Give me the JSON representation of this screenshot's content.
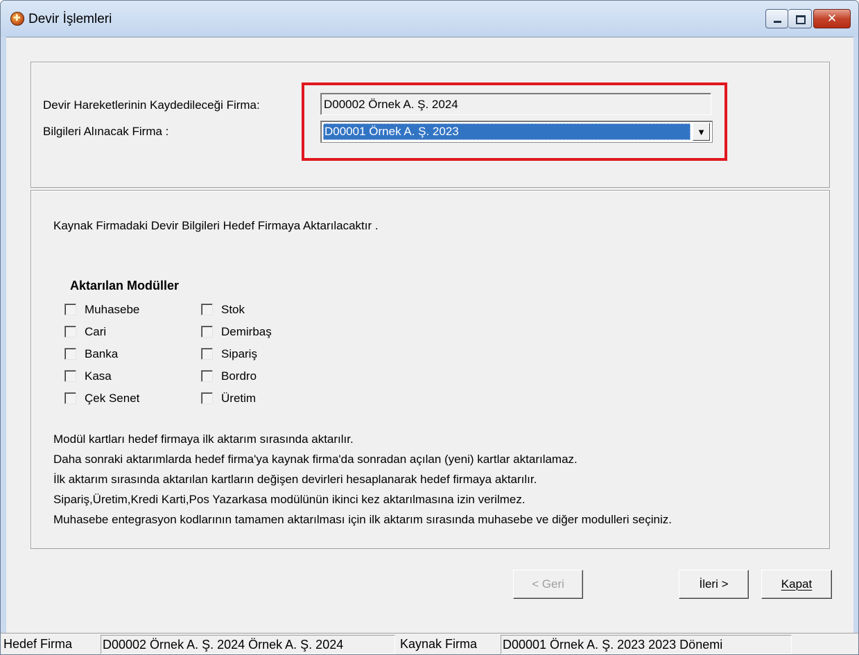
{
  "window": {
    "title": "Devir İşlemleri",
    "controls": {
      "minimize": "minimize",
      "maximize": "maximize",
      "close": "✕"
    }
  },
  "form": {
    "target_label": "Devir Hareketlerinin Kaydedileceği Firma:",
    "target_value": "D00002 Örnek A. Ş. 2024",
    "source_label": "Bilgileri Alınacak Firma :",
    "source_value": "D00001 Örnek A. Ş. 2023",
    "highlight_color": "#e0181f"
  },
  "info": {
    "intro": "Kaynak Firmadaki Devir Bilgileri Hedef Firmaya  Aktarılacaktır .",
    "modules_title": "Aktarılan Modüller",
    "modules_left": [
      {
        "label": "Muhasebe",
        "checked": false
      },
      {
        "label": "Cari",
        "checked": false
      },
      {
        "label": "Banka",
        "checked": false
      },
      {
        "label": "Kasa",
        "checked": false
      },
      {
        "label": "Çek Senet",
        "checked": false
      }
    ],
    "modules_right": [
      {
        "label": "Stok",
        "checked": false
      },
      {
        "label": "Demirbaş",
        "checked": false
      },
      {
        "label": "Sipariş",
        "checked": false
      },
      {
        "label": "Bordro",
        "checked": false
      },
      {
        "label": "Üretim",
        "checked": false
      }
    ],
    "notes": [
      "Modül kartları  hedef firmaya ilk aktarım sırasında  aktarılır.",
      "Daha sonraki aktarımlarda hedef firma'ya kaynak firma'da sonradan açılan  (yeni)  kartlar aktarılamaz.",
      "İlk aktarım sırasında aktarılan kartların değişen devirleri hesaplanarak hedef firmaya aktarılır.",
      "Sipariş,Üretim,Kredi Karti,Pos Yazarkasa  modülünün ikinci kez aktarılmasına izin verilmez.",
      "Muhasebe entegrasyon kodlarının tamamen aktarılması için ilk aktarım sırasında muhasebe ve diğer modulleri seçiniz."
    ]
  },
  "buttons": {
    "back": "< Geri",
    "next": "İleri >",
    "close": "Kapat"
  },
  "statusbar": {
    "target_label": "Hedef Firma",
    "target_value": "D00002 Örnek A. Ş. 2024 Örnek A. Ş. 2024",
    "source_label": "Kaynak Firma",
    "source_value": "D00001 Örnek A. Ş. 2023  2023 Dönemi"
  }
}
